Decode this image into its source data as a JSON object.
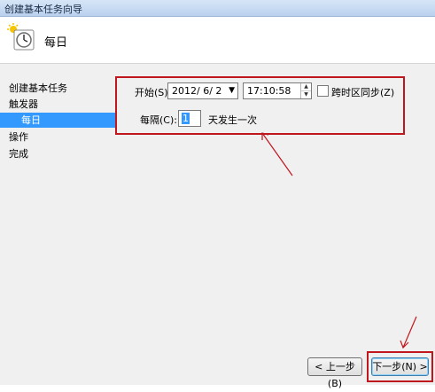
{
  "window": {
    "title": "创建基本任务向导"
  },
  "header": {
    "title": "每日",
    "icon": "clock-icon"
  },
  "nav": {
    "items": [
      {
        "label": "创建基本任务"
      },
      {
        "label": "触发器"
      },
      {
        "label": "每日"
      },
      {
        "label": "操作"
      },
      {
        "label": "完成"
      }
    ]
  },
  "schedule": {
    "start_label": "开始(S):",
    "start_date": "2012/ 6/ 2",
    "start_time": "17:10:58",
    "sync_timezones_label": "跨时区同步(Z)",
    "recur_label": "每隔(C):",
    "recur_value": "1",
    "recur_suffix": "天发生一次"
  },
  "buttons": {
    "back": "< 上一步(B)",
    "next": "下一步(N) >"
  },
  "colors": {
    "annotation": "#c0161d",
    "selection": "#3399ff"
  }
}
